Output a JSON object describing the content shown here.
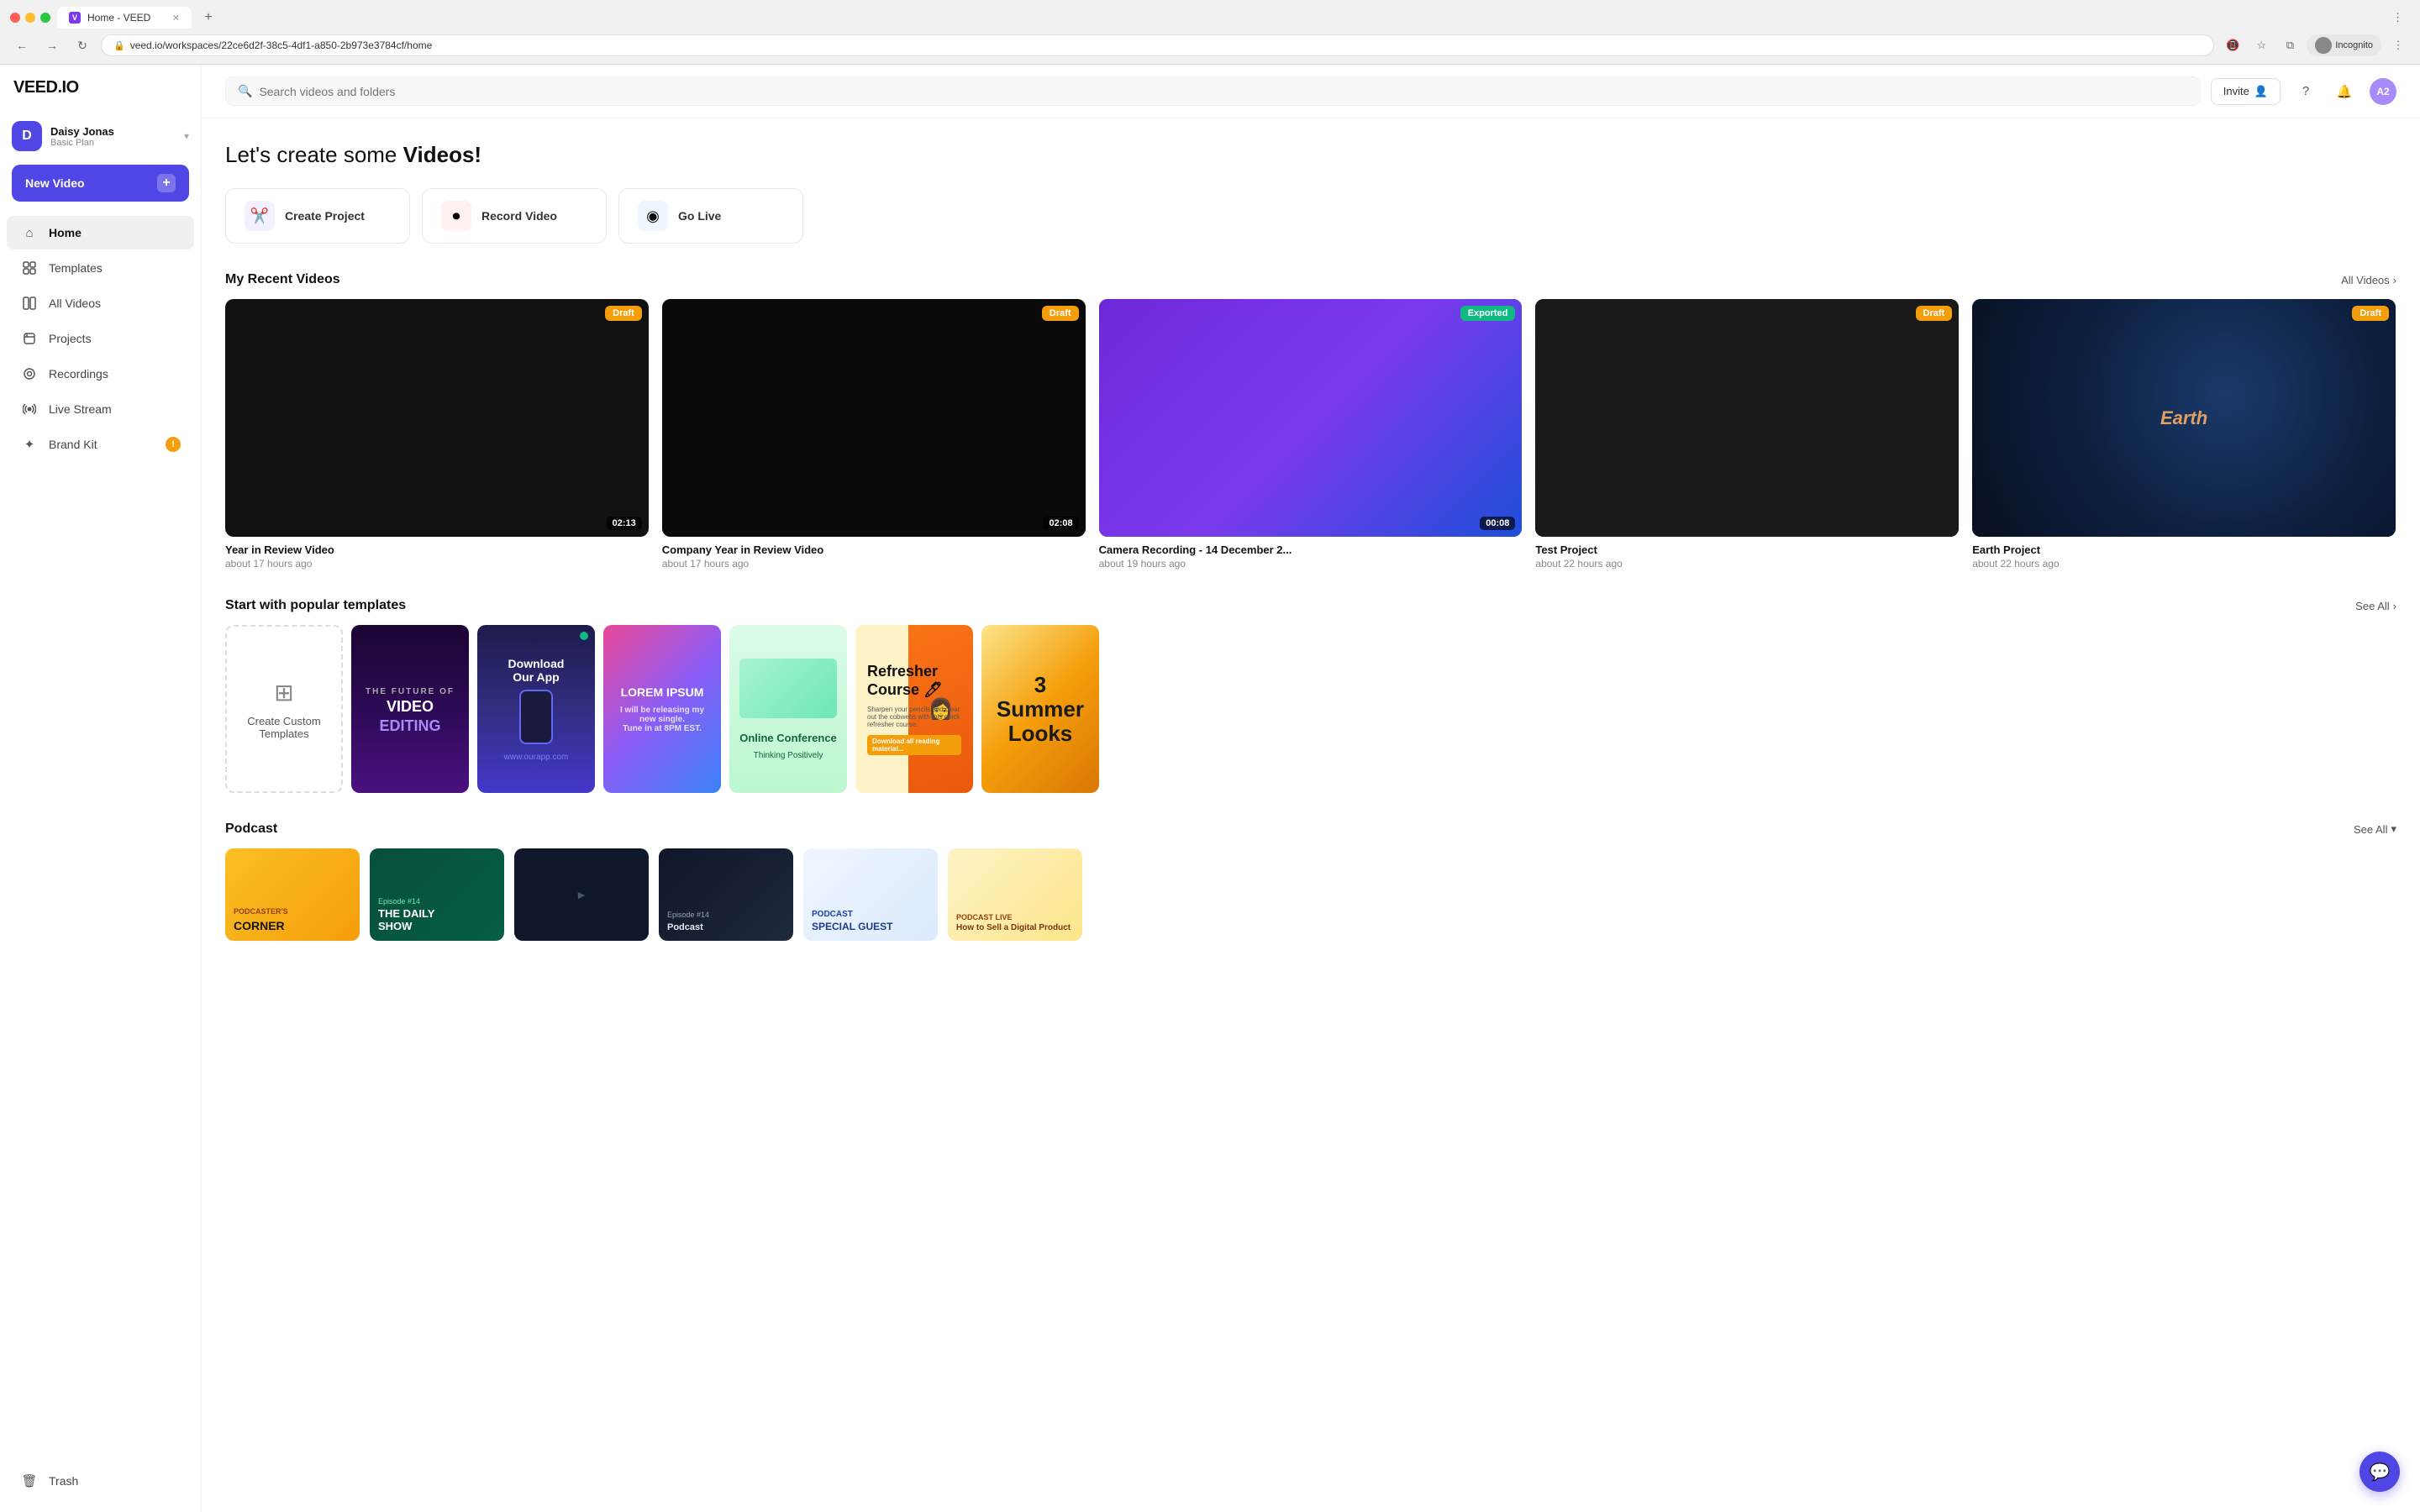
{
  "browser": {
    "tab_title": "Home - VEED",
    "tab_icon": "V",
    "address": "veed.io/workspaces/22ce6d2f-38c5-4df1-a850-2b973e3784cf/home",
    "incognito_label": "Incognito"
  },
  "logo": "VEED.IO",
  "user": {
    "initial": "D",
    "name": "Daisy Jonas",
    "plan": "Basic Plan"
  },
  "sidebar": {
    "new_video_label": "New Video",
    "nav_items": [
      {
        "label": "Home",
        "icon": "⌂",
        "active": true
      },
      {
        "label": "Templates",
        "icon": "☰"
      },
      {
        "label": "All Videos",
        "icon": "⊞"
      },
      {
        "label": "Projects",
        "icon": "📁"
      },
      {
        "label": "Recordings",
        "icon": "⊙"
      },
      {
        "label": "Live Stream",
        "icon": "◉"
      },
      {
        "label": "Brand Kit",
        "icon": "✦",
        "badge": "!"
      }
    ],
    "trash_label": "Trash"
  },
  "topbar": {
    "search_placeholder": "Search videos and folders",
    "invite_label": "Invite"
  },
  "page": {
    "headline_part1": "Let's create some ",
    "headline_part2": "Videos!"
  },
  "action_cards": [
    {
      "label": "Create Project",
      "icon": "✂",
      "icon_type": "purple"
    },
    {
      "label": "Record Video",
      "icon": "⏺",
      "icon_type": "red"
    },
    {
      "label": "Go Live",
      "icon": "◉",
      "icon_type": "blue"
    }
  ],
  "recent_videos": {
    "section_title": "My Recent Videos",
    "all_videos_label": "All Videos",
    "videos": [
      {
        "title": "Year in Review Video",
        "time": "about 17 hours ago",
        "badge": "Draft",
        "badge_type": "draft",
        "duration": "02:13",
        "thumb": "year"
      },
      {
        "title": "Company Year in Review Video",
        "time": "about 17 hours ago",
        "badge": "Draft",
        "badge_type": "draft",
        "duration": "02:08",
        "thumb": "dark"
      },
      {
        "title": "Camera Recording - 14 December 2...",
        "time": "about 19 hours ago",
        "badge": "Exported",
        "badge_type": "exported",
        "duration": "00:08",
        "thumb": "purple"
      },
      {
        "title": "Test Project",
        "time": "about 22 hours ago",
        "badge": "Draft",
        "badge_type": "draft",
        "duration": "",
        "thumb": "dark2"
      },
      {
        "title": "Earth Project",
        "time": "about 22 hours ago",
        "badge": "Draft",
        "badge_type": "draft",
        "duration": "",
        "thumb": "earth"
      }
    ]
  },
  "templates": {
    "section_title": "Start with popular templates",
    "see_all_label": "See All",
    "create_label": "Create Custom Templates",
    "items": [
      {
        "type": "create"
      },
      {
        "type": "future",
        "text1": "The Future of",
        "text2": "Video Editing"
      },
      {
        "type": "download",
        "text": "Download Our App",
        "dot": true
      },
      {
        "type": "colorful",
        "text": "Lorem Ipsum"
      },
      {
        "type": "conference",
        "title": "Online Conference",
        "sub": "Thinking Positively"
      },
      {
        "type": "refresher",
        "text": "Refresher Course 🖊"
      },
      {
        "type": "summer",
        "text": "3 Summer Looks"
      }
    ]
  },
  "podcast": {
    "section_title": "Podcast",
    "see_all_label": "See All",
    "items": [
      {
        "type": "yellow",
        "title": "Podcaster's Corner"
      },
      {
        "type": "green",
        "title": "The Daily Show",
        "ep": "Episode #14"
      },
      {
        "type": "dark"
      },
      {
        "type": "ep",
        "text": "Episode #14"
      },
      {
        "type": "special",
        "title": "Podcast Special Guest"
      },
      {
        "type": "live",
        "title": "Podcast Live - How to Sell a Digital Product"
      }
    ]
  }
}
